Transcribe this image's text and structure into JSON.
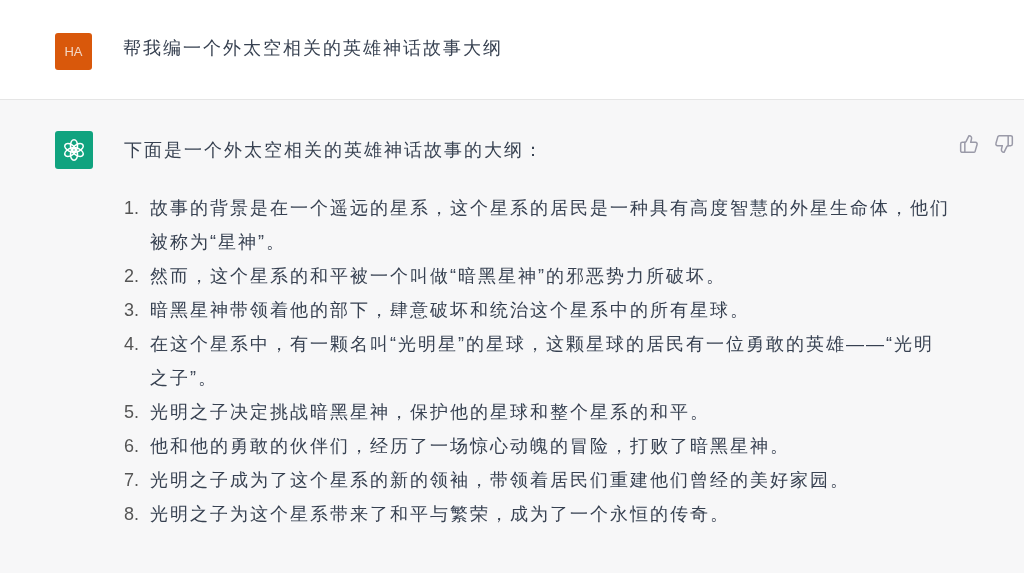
{
  "user_message": {
    "avatar": "HA",
    "text": "帮我编一个外太空相关的英雄神话故事大纲"
  },
  "assistant_message": {
    "intro": "下面是一个外太空相关的英雄神话故事的大纲：",
    "items": [
      {
        "number": "1.",
        "text": "故事的背景是在一个遥远的星系，这个星系的居民是一种具有高度智慧的外星生命体，他们被称为“星神”。"
      },
      {
        "number": "2.",
        "text": "然而，这个星系的和平被一个叫做“暗黑星神”的邪恶势力所破坏。"
      },
      {
        "number": "3.",
        "text": "暗黑星神带领着他的部下，肆意破坏和统治这个星系中的所有星球。"
      },
      {
        "number": "4.",
        "text": "在这个星系中，有一颗名叫“光明星”的星球，这颗星球的居民有一位勇敢的英雄——“光明之子”。"
      },
      {
        "number": "5.",
        "text": "光明之子决定挑战暗黑星神，保护他的星球和整个星系的和平。"
      },
      {
        "number": "6.",
        "text": "他和他的勇敢的伙伴们，经历了一场惊心动魄的冒险，打败了暗黑星神。"
      },
      {
        "number": "7.",
        "text": "光明之子成为了这个星系的新的领袖，带领着居民们重建他们曾经的美好家园。"
      },
      {
        "number": "8.",
        "text": "光明之子为这个星系带来了和平与繁荣，成为了一个永恒的传奇。"
      }
    ]
  }
}
